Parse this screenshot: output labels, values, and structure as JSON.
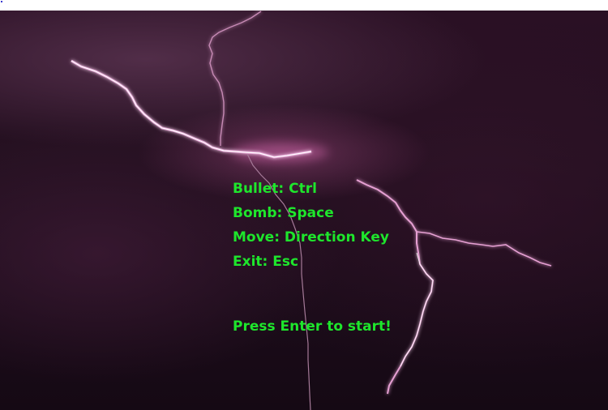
{
  "scene": {
    "background": "night-sky-lightning",
    "text_color": "#1ee62c"
  },
  "controls": {
    "bullet": "Bullet: Ctrl",
    "bomb": "Bomb: Space",
    "move": "Move: Direction Key",
    "exit": "Exit: Esc"
  },
  "prompt": "Press Enter to start!"
}
